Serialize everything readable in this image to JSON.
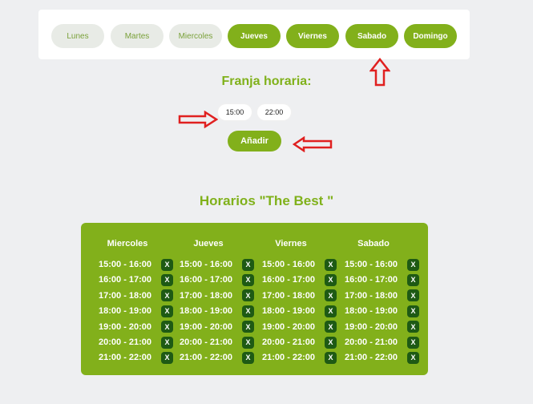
{
  "days": [
    {
      "label": "Lunes",
      "selected": false
    },
    {
      "label": "Martes",
      "selected": false
    },
    {
      "label": "Miercoles",
      "selected": false
    },
    {
      "label": "Jueves",
      "selected": true
    },
    {
      "label": "Viernes",
      "selected": true
    },
    {
      "label": "Sabado",
      "selected": true
    },
    {
      "label": "Domingo",
      "selected": true
    }
  ],
  "time_range": {
    "title": "Franja horaria:",
    "start": "15:00",
    "end": "22:00",
    "add_label": "Añadir"
  },
  "schedule": {
    "title": "Horarios \"The Best \"",
    "remove_label": "X",
    "columns": [
      {
        "day": "Miercoles",
        "slots": [
          "15:00 - 16:00",
          "16:00 - 17:00",
          "17:00 - 18:00",
          "18:00 - 19:00",
          "19:00 - 20:00",
          "20:00 - 21:00",
          "21:00 - 22:00"
        ]
      },
      {
        "day": "Jueves",
        "slots": [
          "15:00 - 16:00",
          "16:00 - 17:00",
          "17:00 - 18:00",
          "18:00 - 19:00",
          "19:00 - 20:00",
          "20:00 - 21:00",
          "21:00 - 22:00"
        ]
      },
      {
        "day": "Viernes",
        "slots": [
          "15:00 - 16:00",
          "16:00 - 17:00",
          "17:00 - 18:00",
          "18:00 - 19:00",
          "19:00 - 20:00",
          "20:00 - 21:00",
          "21:00 - 22:00"
        ]
      },
      {
        "day": "Sabado",
        "slots": [
          "15:00 - 16:00",
          "16:00 - 17:00",
          "17:00 - 18:00",
          "18:00 - 19:00",
          "19:00 - 20:00",
          "20:00 - 21:00",
          "21:00 - 22:00"
        ]
      }
    ]
  },
  "colors": {
    "accent": "#82b01b",
    "remove_button": "#1e5a14",
    "annotation_arrow": "#e02020",
    "unselected_day": "#e8ebe6"
  }
}
